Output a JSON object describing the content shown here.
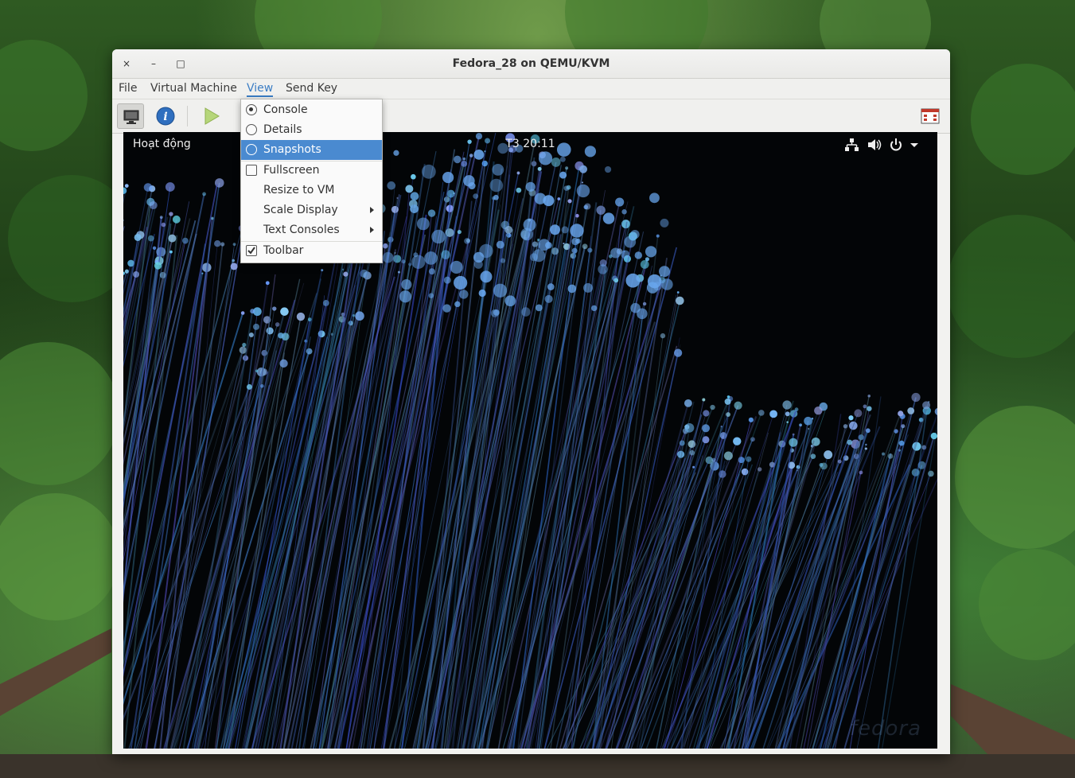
{
  "window": {
    "title": "Fedora_28 on QEMU/KVM"
  },
  "titlebar_buttons": {
    "close": "×",
    "minimize": "–",
    "maximize": "□"
  },
  "menubar": {
    "items": [
      {
        "label": "File"
      },
      {
        "label": "Virtual Machine"
      },
      {
        "label": "View"
      },
      {
        "label": "Send Key"
      }
    ]
  },
  "toolbar": {
    "buttons": [
      {
        "icon": "monitor-icon",
        "pressed": true
      },
      {
        "icon": "info-icon"
      },
      {
        "icon": "play-icon"
      }
    ],
    "right_icon": "fullscreen-icon"
  },
  "view_menu": {
    "items": [
      {
        "label": "Console",
        "type": "radio",
        "checked": true
      },
      {
        "label": "Details",
        "type": "radio",
        "checked": false
      },
      {
        "label": "Snapshots",
        "type": "radio",
        "checked": false,
        "highlighted": true
      },
      {
        "label": "Fullscreen",
        "type": "check",
        "checked": false
      },
      {
        "label": "Resize to VM",
        "type": "plain"
      },
      {
        "label": "Scale Display",
        "type": "submenu"
      },
      {
        "label": "Text Consoles",
        "type": "submenu"
      },
      {
        "label": "Toolbar",
        "type": "check",
        "checked": true
      }
    ]
  },
  "guest": {
    "activities": "Hoạt động",
    "clock": "T3 20:11",
    "tray_icons": [
      "network-icon",
      "volume-icon",
      "power-icon",
      "chevron-down-icon"
    ],
    "watermark": "fedora"
  }
}
